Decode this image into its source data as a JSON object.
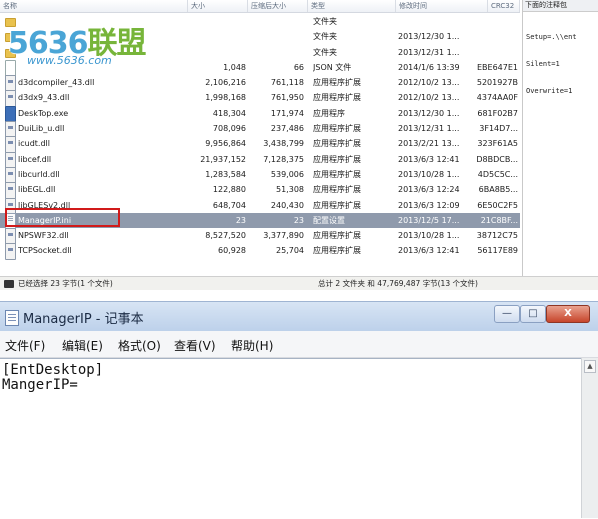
{
  "archive": {
    "columns": [
      "名称",
      "大小",
      "压缩后大小",
      "类型",
      "修改时间",
      "CRC32"
    ],
    "rows": [
      {
        "icon": "folder-icon",
        "name": "",
        "size": "",
        "packed": "",
        "type": "文件夹",
        "modified": "",
        "crc": ""
      },
      {
        "icon": "folder-icon",
        "name": "",
        "size": "",
        "packed": "",
        "type": "文件夹",
        "modified": "2013/12/30 1...",
        "crc": ""
      },
      {
        "icon": "folder-icon",
        "name": "",
        "size": "",
        "packed": "",
        "type": "文件夹",
        "modified": "2013/12/31 1...",
        "crc": ""
      },
      {
        "icon": "json-icon",
        "name": "",
        "size": "1,048",
        "packed": "66",
        "type": "JSON 文件",
        "modified": "2014/1/6 13:39",
        "crc": "EBE647E1"
      },
      {
        "icon": "dll-icon",
        "name": "d3dcompiler_43.dll",
        "size": "2,106,216",
        "packed": "761,118",
        "type": "应用程序扩展",
        "modified": "2012/10/2 13...",
        "crc": "5201927B"
      },
      {
        "icon": "dll-icon",
        "name": "d3dx9_43.dll",
        "size": "1,998,168",
        "packed": "761,950",
        "type": "应用程序扩展",
        "modified": "2012/10/2 13...",
        "crc": "4374AA0F"
      },
      {
        "icon": "exe-icon",
        "name": "DeskTop.exe",
        "size": "418,304",
        "packed": "171,974",
        "type": "应用程序",
        "modified": "2013/12/30 1...",
        "crc": "681F02B7"
      },
      {
        "icon": "dll-icon",
        "name": "DuiLib_u.dll",
        "size": "708,096",
        "packed": "237,486",
        "type": "应用程序扩展",
        "modified": "2013/12/31 1...",
        "crc": "3F14D7..."
      },
      {
        "icon": "dll-icon",
        "name": "icudt.dll",
        "size": "9,956,864",
        "packed": "3,438,799",
        "type": "应用程序扩展",
        "modified": "2013/2/21 13...",
        "crc": "323F61A5"
      },
      {
        "icon": "dll-icon",
        "name": "libcef.dll",
        "size": "21,937,152",
        "packed": "7,128,375",
        "type": "应用程序扩展",
        "modified": "2013/6/3 12:41",
        "crc": "D8BDCB..."
      },
      {
        "icon": "dll-icon",
        "name": "libcurld.dll",
        "size": "1,283,584",
        "packed": "539,006",
        "type": "应用程序扩展",
        "modified": "2013/10/28 1...",
        "crc": "4D5C5C..."
      },
      {
        "icon": "dll-icon",
        "name": "libEGL.dll",
        "size": "122,880",
        "packed": "51,308",
        "type": "应用程序扩展",
        "modified": "2013/6/3 12:24",
        "crc": "6BA8B5..."
      },
      {
        "icon": "dll-icon",
        "name": "libGLESv2.dll",
        "size": "648,704",
        "packed": "240,430",
        "type": "应用程序扩展",
        "modified": "2013/6/3 12:09",
        "crc": "6E50C2F5"
      },
      {
        "icon": "ini-icon",
        "name": "ManagerIP.ini",
        "size": "23",
        "packed": "23",
        "type": "配置设置",
        "modified": "2013/12/5 17...",
        "crc": "21C8BF...",
        "selected": true
      },
      {
        "icon": "dll-icon",
        "name": "NPSWF32.dll",
        "size": "8,527,520",
        "packed": "3,377,890",
        "type": "应用程序扩展",
        "modified": "2013/10/28 1...",
        "crc": "38712C75"
      },
      {
        "icon": "dll-icon",
        "name": "TCPSocket.dll",
        "size": "60,928",
        "packed": "25,704",
        "type": "应用程序扩展",
        "modified": "2013/6/3 12:41",
        "crc": "56117E89"
      }
    ],
    "status_left": "已经选择 23 字节(1 个文件)",
    "status_right": "总计 2 文件夹 和 47,769,487 字节(13 个文件)"
  },
  "watermark": {
    "logo_main": "5636",
    "logo_cn": "联盟",
    "url": "www.5636.com"
  },
  "side_pane": {
    "title": "下面的注释包",
    "lines": [
      "Setup=.\\\\ent",
      "Silent=1",
      "Overwrite=1"
    ]
  },
  "notepad": {
    "title": "ManagerIP - 记事本",
    "menu": [
      "文件(F)",
      "编辑(E)",
      "格式(O)",
      "查看(V)",
      "帮助(H)"
    ],
    "buttons": {
      "minimize": "—",
      "maximize": "□",
      "close": "X"
    },
    "content_lines": [
      "[EntDesktop]",
      "MangerIP="
    ]
  },
  "colors": {
    "selection": "#8f9aac",
    "highlight_border": "#d11a1a",
    "notepad_frame": "#c5d6eb"
  }
}
